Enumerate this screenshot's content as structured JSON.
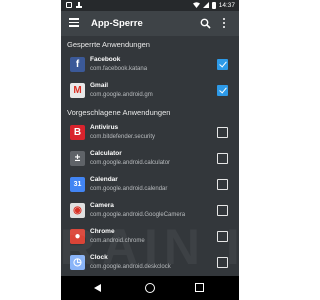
{
  "status_bar": {
    "time": "14:37"
  },
  "app_bar": {
    "title": "App-Sperre",
    "icons": [
      "menu-icon",
      "search-icon",
      "more-vert-icon"
    ]
  },
  "sections": {
    "locked": {
      "header": "Gesperrte Anwendungen",
      "items": [
        {
          "name": "Facebook",
          "package": "com.facebook.katana",
          "checked": true,
          "icon": "facebook-icon",
          "icon_color": "#3b5998",
          "glyph": "f"
        },
        {
          "name": "Gmail",
          "package": "com.google.android.gm",
          "checked": true,
          "icon": "gmail-icon",
          "icon_color": "#e8e8e8",
          "glyph": "M"
        }
      ]
    },
    "suggested": {
      "header": "Vorgeschlagene Anwendungen",
      "items": [
        {
          "name": "Antivirus",
          "package": "com.bitdefender.security",
          "checked": false,
          "icon": "antivirus-icon",
          "icon_color": "#d9232d",
          "glyph": "B"
        },
        {
          "name": "Calculator",
          "package": "com.google.android.calculator",
          "checked": false,
          "icon": "calculator-icon",
          "icon_color": "#5f6368",
          "glyph": "±"
        },
        {
          "name": "Calendar",
          "package": "com.google.android.calendar",
          "checked": false,
          "icon": "calendar-icon",
          "icon_color": "#4285f4",
          "glyph": "31"
        },
        {
          "name": "Camera",
          "package": "com.google.android.GoogleCamera",
          "checked": false,
          "icon": "camera-icon",
          "icon_color": "#e0e0e0",
          "glyph": "◉"
        },
        {
          "name": "Chrome",
          "package": "com.android.chrome",
          "checked": false,
          "icon": "chrome-icon",
          "icon_color": "#db4437",
          "glyph": "●"
        },
        {
          "name": "Clock",
          "package": "com.google.android.deskclock",
          "checked": false,
          "icon": "clock-icon",
          "icon_color": "#8ab4f8",
          "glyph": "◷"
        }
      ]
    }
  },
  "nav_bar": {
    "icons": [
      "back-icon",
      "home-icon",
      "recent-apps-icon"
    ]
  },
  "watermark": "BRAIN IT",
  "colors": {
    "background": "#33373b",
    "app_bar": "#3e4347",
    "checkbox_checked": "#2d9ae8"
  }
}
